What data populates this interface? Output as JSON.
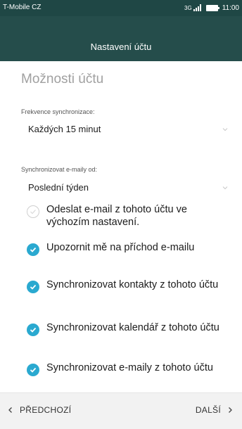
{
  "status_bar": {
    "carrier": "T-Mobile CZ",
    "network": "3G",
    "time": "11:00"
  },
  "app_bar": {
    "title": "Nastavení účtu"
  },
  "main": {
    "section_title": "Možnosti účtu",
    "sync_frequency": {
      "label": "Frekvence synchronizace:",
      "value": "Každých 15 minut"
    },
    "sync_emails_from": {
      "label": "Synchronizovat e-maily od:",
      "value": "Poslední týden"
    },
    "options": [
      {
        "label": "Odeslat e-mail z tohoto účtu ve výchozím nastavení.",
        "checked": false
      },
      {
        "label": "Upozornit mě na příchod e-mailu",
        "checked": true
      },
      {
        "label": "Synchronizovat kontakty z tohoto účtu",
        "checked": true
      },
      {
        "label": "Synchronizovat kalendář z tohoto účtu",
        "checked": true
      },
      {
        "label": "Synchronizovat e-maily z tohoto účtu",
        "checked": true
      }
    ]
  },
  "footer": {
    "prev_label": "PŘEDCHOZÍ",
    "next_label": "DALŠÍ"
  },
  "colors": {
    "status_bar": "#1f4745",
    "app_bar": "#254d4b",
    "accent": "#2aa9d0"
  }
}
